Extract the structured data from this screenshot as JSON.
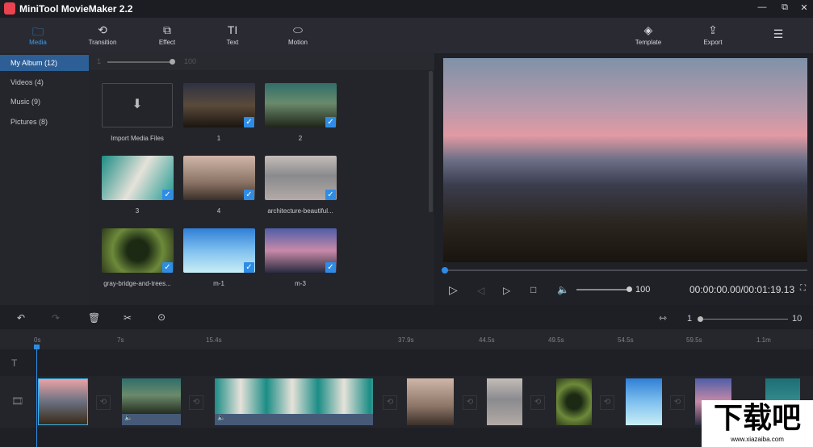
{
  "app": {
    "title": "MiniTool MovieMaker 2.2"
  },
  "window": {
    "minimize": "—",
    "restore": "⧉",
    "close": "✕"
  },
  "toolbar": {
    "items": [
      {
        "label": "Media",
        "icon": "folder-icon"
      },
      {
        "label": "Transition",
        "icon": "transition-icon"
      },
      {
        "label": "Effect",
        "icon": "effect-icon"
      },
      {
        "label": "Text",
        "icon": "text-icon"
      },
      {
        "label": "Motion",
        "icon": "motion-icon"
      }
    ],
    "template": "Template",
    "export": "Export"
  },
  "sidebar": {
    "items": [
      "My Album  (12)",
      "Videos  (4)",
      "Music  (9)",
      "Pictures  (8)"
    ]
  },
  "media": {
    "zoom_min": "1",
    "zoom_max": "100",
    "zoom_value": 100,
    "import_label": "Import Media Files",
    "items": [
      "1",
      "2",
      "3",
      "4",
      "architecture-beautiful...",
      "gray-bridge-and-trees...",
      "m-1",
      "m-3"
    ]
  },
  "player": {
    "volume": "100",
    "progress": 0,
    "time": "00:00:00.00/00:01:19.13"
  },
  "timeline": {
    "zoom_min": "1",
    "zoom_max": "10",
    "zoom_value": 1,
    "ticks": [
      "0s",
      "7s",
      "15.4s",
      "37.9s",
      "44.5s",
      "49.5s",
      "54.5s",
      "59.5s",
      "1.1m"
    ]
  },
  "watermark": {
    "text": "下载吧",
    "url": "www.xiazaiba.com"
  }
}
